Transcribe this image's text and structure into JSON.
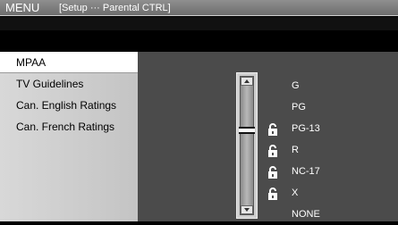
{
  "titlebar": {
    "menu": "MENU",
    "breadcrumb": "[Setup ··· Parental CTRL]"
  },
  "sidebar": {
    "items": [
      {
        "label": "MPAA",
        "selected": true
      },
      {
        "label": "TV Guidelines",
        "selected": false
      },
      {
        "label": "Can. English Ratings",
        "selected": false
      },
      {
        "label": "Can. French Ratings",
        "selected": false
      }
    ]
  },
  "ratings": [
    {
      "label": "G",
      "locked": false
    },
    {
      "label": "PG",
      "locked": false
    },
    {
      "label": "PG-13",
      "locked": true
    },
    {
      "label": "R",
      "locked": true
    },
    {
      "label": "NC-17",
      "locked": true
    },
    {
      "label": "X",
      "locked": true
    },
    {
      "label": "NONE",
      "locked": false
    }
  ],
  "icons": {
    "lock": "lock-icon",
    "slider_up": "chevron-up-icon",
    "slider_down": "chevron-down-icon"
  },
  "colors": {
    "titlebar": "#7a7a7a",
    "sidebar": "#cdcdcd",
    "selected": "#ffffff",
    "main": "#4b4b4b",
    "text_light": "#ffffff"
  }
}
